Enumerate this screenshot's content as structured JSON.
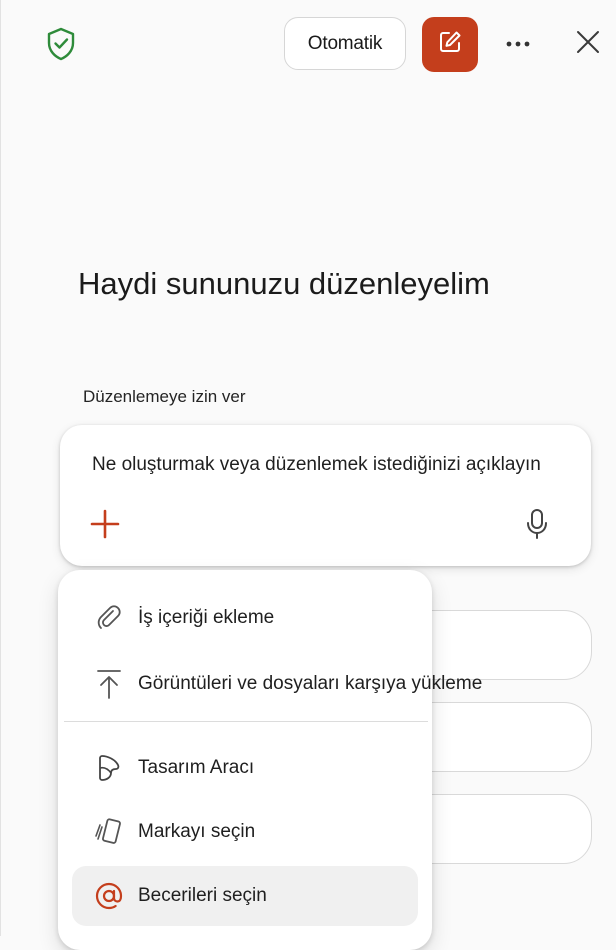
{
  "header": {
    "auto_label": "Otomatik",
    "icons": {
      "shield": "shield-check-icon",
      "edit": "compose-icon",
      "more": "more-icon",
      "close": "close-icon"
    },
    "colors": {
      "accent": "#c43e1c",
      "shield": "#2e8b3a"
    }
  },
  "main": {
    "title": "Haydi sununuzu düzenleyelim",
    "section_label": "Düzenlemeye izin ver",
    "prompt_placeholder": "Ne oluşturmak veya düzenlemek istediğinizi açıklayın"
  },
  "menu": {
    "items": [
      {
        "label": "İş içeriği ekleme",
        "icon": "paperclip-icon"
      },
      {
        "label": "Görüntüleri ve dosyaları karşıya yükleme",
        "icon": "upload-icon"
      },
      {
        "label": "Tasarım Aracı",
        "icon": "designer-icon"
      },
      {
        "label": "Markayı seçin",
        "icon": "brand-icon"
      },
      {
        "label": "Becerileri seçin",
        "icon": "at-sign-icon"
      }
    ]
  }
}
